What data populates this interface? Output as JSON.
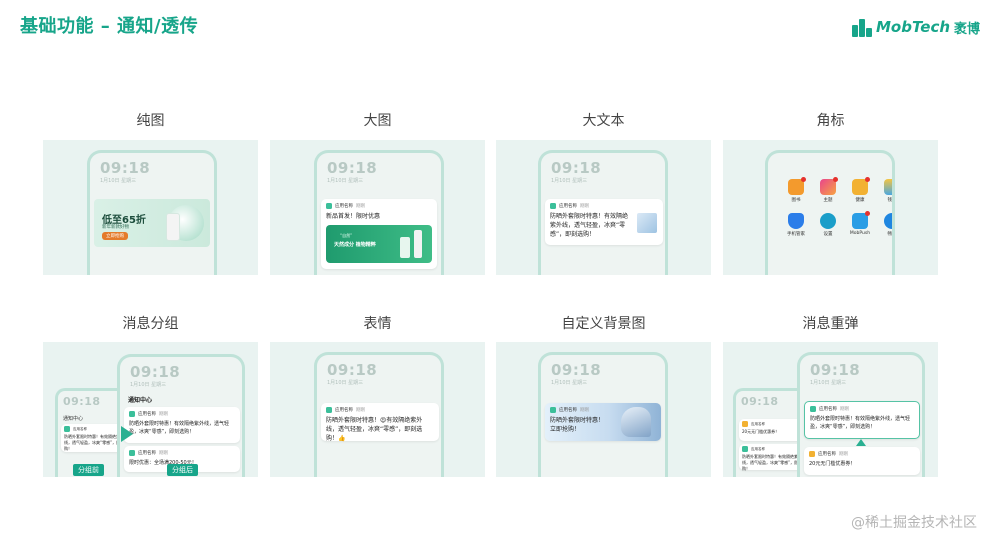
{
  "header": {
    "title": "基础功能 – 通知/透传",
    "logo_text": "MobTech",
    "logo_cn": "袤博"
  },
  "colors": {
    "accent": "#17a58a",
    "card_bg": "#e9f3f1",
    "phone_border": "#bfe2d8"
  },
  "phone": {
    "time": "09:18",
    "date": "1月10日 星期三"
  },
  "features": [
    {
      "label": "纯图"
    },
    {
      "label": "大图"
    },
    {
      "label": "大文本"
    },
    {
      "label": "角标"
    },
    {
      "label": "消息分组"
    },
    {
      "label": "表情"
    },
    {
      "label": "自定义背景图"
    },
    {
      "label": "消息重弹"
    }
  ],
  "pure_image": {
    "headline": "低至65折",
    "sub": "新年新款好物",
    "button": "立即抢购"
  },
  "big_image": {
    "app_name": "应用名称",
    "app_time": "刚刚",
    "text": "新品首发！限时优惠",
    "banner_small": "“自然”",
    "banner_main": "天然成分 植物精粹"
  },
  "big_text": {
    "app_name": "应用名称",
    "app_time": "刚刚",
    "text": "防晒外套限时特惠！有效隔绝紫外线，透气轻盈，冰爽“零感”，即刻选购！"
  },
  "badge_apps": [
    {
      "name": "图书",
      "color": "#f39a2d",
      "icon": "book-icon"
    },
    {
      "name": "主题",
      "color": "#e9448c",
      "icon": "theme-icon"
    },
    {
      "name": "健康",
      "color": "#f2b132",
      "icon": "heart-icon"
    },
    {
      "name": "钱包",
      "color": "#f4c542",
      "icon": "wallet-icon"
    },
    {
      "name": "手机管家",
      "color": "#2b7de9",
      "icon": "shield-icon"
    },
    {
      "name": "设置",
      "color": "#1a9ec9",
      "icon": "gear-icon"
    },
    {
      "name": "MobPush",
      "color": "#2a9de5",
      "icon": "send-icon"
    },
    {
      "name": "畅连",
      "color": "#1f86e0",
      "icon": "chat-icon"
    }
  ],
  "group": {
    "center_title": "通知中心",
    "app_name": "应用名称",
    "app_time": "刚刚",
    "msg1": "防晒外套限时特惠！有效隔绝紫外线，透气轻盈，冰爽“零感”，即刻选购！",
    "msg2": "限时优惠：全场满200-50元！",
    "back_msg": "防晒外套限时特惠！有效隔绝紫外线，透气轻盈，冰爽“零感”，即刻选购！",
    "before": "分组前",
    "after": "分组后"
  },
  "emoji": {
    "app_name": "应用名称",
    "app_time": "刚刚",
    "text": "防晒外套限时特惠！😍有效隔绝紫外线，透气轻盈，冰爽“零感”，即刻选购！👍"
  },
  "custom_bg": {
    "app_name": "应用名称",
    "app_time": "刚刚",
    "text1": "防晒外套限时特惠！",
    "text2": "立即抢购！"
  },
  "repop": {
    "app_name": "应用名称",
    "app_time": "刚刚",
    "msg1": "防晒外套限时特惠！有效隔绝紫外线，透气轻盈，冰爽“零感”，即刻选购！",
    "msg2": "20元无门槛优惠券！",
    "back_msg1": "20元无门槛优惠券！",
    "back_msg2": "防晒外套限时特惠！有效隔绝紫外线，透气轻盈，冰爽“零感”，即刻选购！"
  },
  "watermark": "@稀土掘金技术社区"
}
